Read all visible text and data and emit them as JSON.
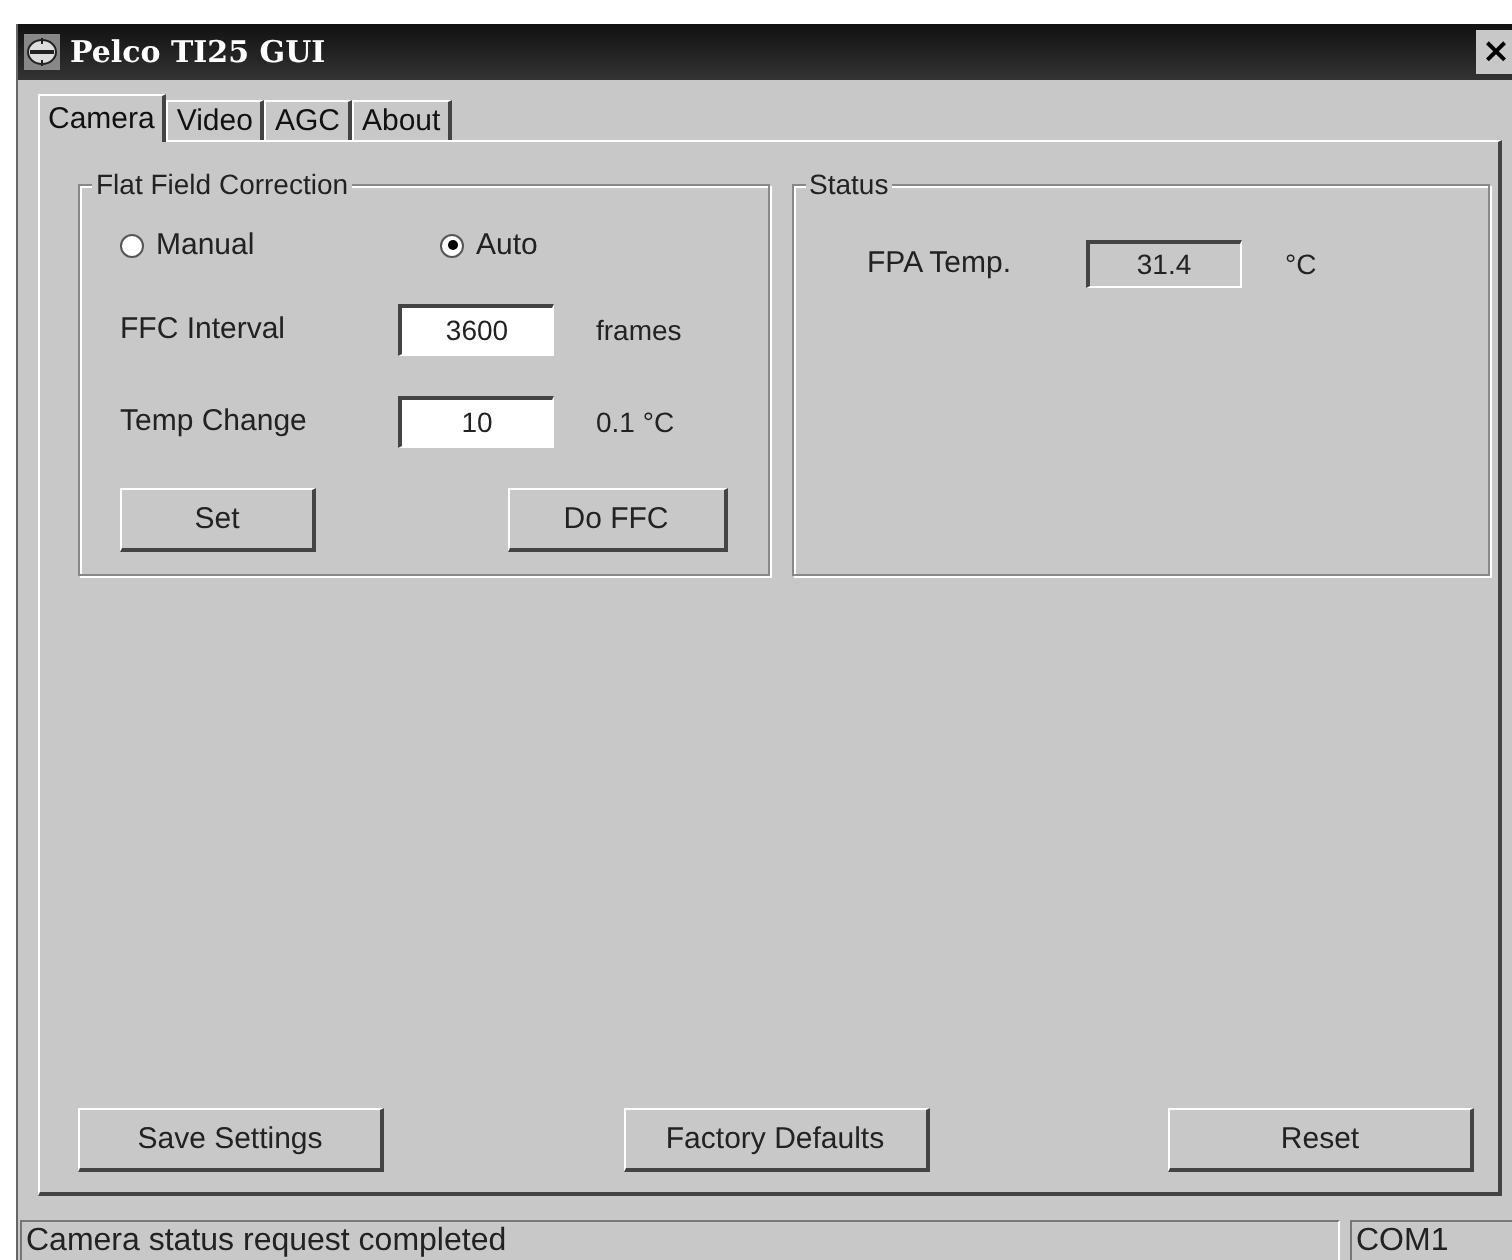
{
  "window": {
    "title": "Pelco TI25 GUI",
    "close": "×"
  },
  "tabs": [
    {
      "label": "Camera",
      "selected": true
    },
    {
      "label": "Video",
      "selected": false
    },
    {
      "label": "AGC",
      "selected": false
    },
    {
      "label": "About",
      "selected": false
    }
  ],
  "ffc": {
    "title": "Flat Field Correction",
    "modes": [
      {
        "label": "Manual",
        "selected": false
      },
      {
        "label": "Auto",
        "selected": true
      }
    ],
    "fields": [
      {
        "label": "FFC Interval",
        "value": "3600",
        "unit": "frames"
      },
      {
        "label": "Temp Change",
        "value": "10",
        "unit": "0.1 °C"
      }
    ],
    "buttons": [
      "Set",
      "Do FFC"
    ]
  },
  "status": {
    "title": "Status",
    "label": "FPA Temp.",
    "value": "31.4",
    "unit": "°C"
  },
  "buttons": [
    "Save Settings",
    "Factory Defaults",
    "Reset"
  ],
  "status_bar": {
    "message": "Camera status request completed",
    "port": "COM1"
  }
}
